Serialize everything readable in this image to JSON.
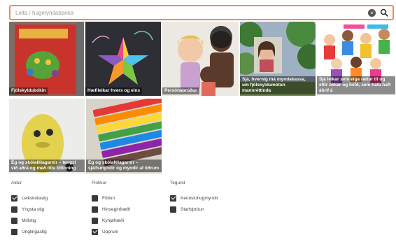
{
  "search": {
    "placeholder": "Leita í hugmyndabanka",
    "clear_icon": "close-circle-icon",
    "search_icon": "search-icon"
  },
  "tiles": [
    {
      "caption": "Fjölskyldubókin"
    },
    {
      "caption": "Hæfileikar hvers og eins"
    },
    {
      "caption": "Persónabrúður"
    },
    {
      "caption": "Sjá, hvernig má myndakassa, um fjölskyldumótun mannréttinda"
    },
    {
      "caption": "Sjá leikar sem eiga rætur til og eftir okkar og hefð, sem hafa haft áhrif á"
    },
    {
      "caption": "Ég og skólafélagarnir – tengsl við aðra og með öllu tilfinning"
    },
    {
      "caption": "Ég og skólafélagarnir – sjálfsmyndir og myndir af öðrum"
    }
  ],
  "filters": {
    "aldur": {
      "heading": "Aldur",
      "items": [
        {
          "label": "Leikskólastig",
          "checked": true
        },
        {
          "label": "Yngsta stig",
          "checked": false
        },
        {
          "label": "Miðstig",
          "checked": false
        },
        {
          "label": "Unglingastig",
          "checked": false
        }
      ]
    },
    "flokkur": {
      "heading": "Flokkur",
      "items": [
        {
          "label": "Fötlun",
          "checked": false
        },
        {
          "label": "Hinseginfræði",
          "checked": false
        },
        {
          "label": "Kynjafræði",
          "checked": false
        },
        {
          "label": "Uppruni",
          "checked": true
        }
      ]
    },
    "tegund": {
      "heading": "Tegund",
      "items": [
        {
          "label": "Kennsluhugmyndir",
          "checked": true
        },
        {
          "label": "Starfsþróun",
          "checked": false
        }
      ]
    }
  },
  "colors": {
    "search_border": "#f08a5d",
    "checkbox": "#3a3a3a"
  }
}
